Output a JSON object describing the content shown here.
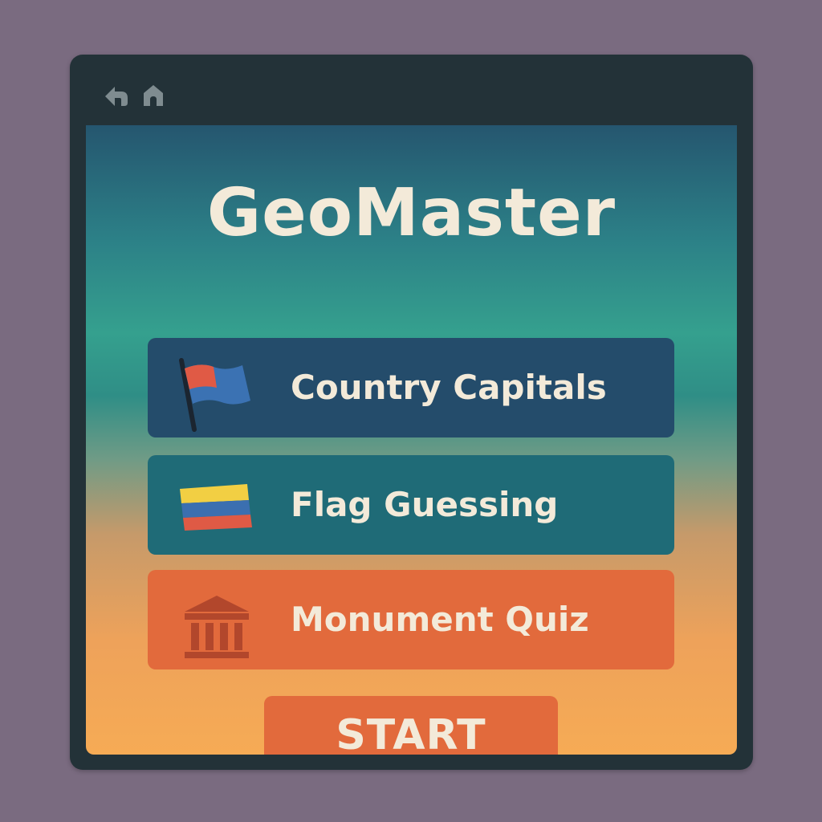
{
  "window": {
    "nav": {
      "back_icon": "back-arrow-icon",
      "home_icon": "home-icon"
    }
  },
  "app": {
    "title": "GeoMaster"
  },
  "modes": [
    {
      "label": "Country Capitals",
      "icon": "flag-icon",
      "color": "#244c6b"
    },
    {
      "label": "Flag Guessing",
      "icon": "tricolor-flag-icon",
      "color": "#1f6b77"
    },
    {
      "label": "Monument Quiz",
      "icon": "monument-icon",
      "color": "#e26a3c"
    }
  ],
  "start_button": {
    "label": "START",
    "color": "#e26a3c"
  },
  "colors": {
    "background": "#7a6b80",
    "window_frame": "#233238",
    "text": "#f3ead9"
  }
}
